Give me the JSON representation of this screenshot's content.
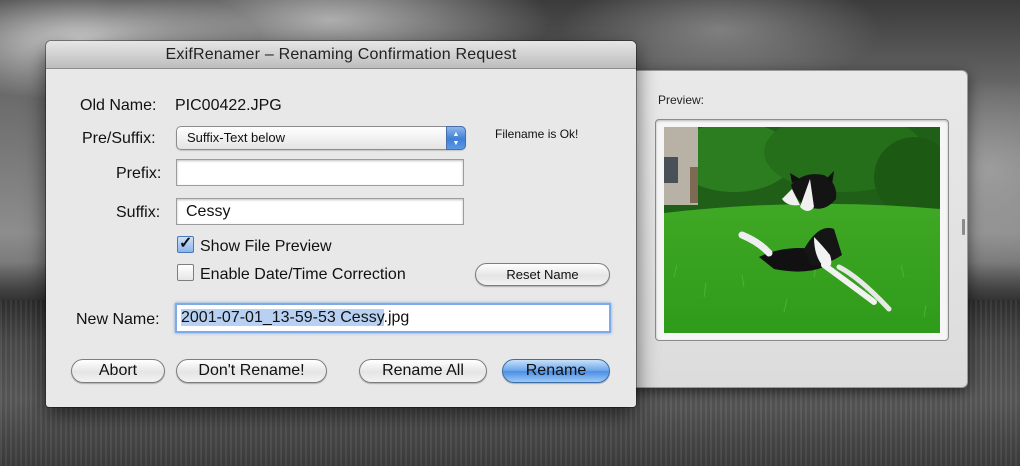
{
  "window": {
    "title": "ExifRenamer  –  Renaming Confirmation Request"
  },
  "form": {
    "old_name_label": "Old Name:",
    "old_name_value": "PIC00422.JPG",
    "presuffix_label": "Pre/Suffix:",
    "presuffix_value": "Suffix-Text below",
    "status_text": "Filename is Ok!",
    "prefix_label": "Prefix:",
    "prefix_value": "",
    "suffix_label": "Suffix:",
    "suffix_value": "Cessy",
    "show_preview_label": "Show File Preview",
    "show_preview_checked": true,
    "date_correction_label": "Enable Date/Time Correction",
    "date_correction_checked": false,
    "reset_name_label": "Reset Name",
    "new_name_label": "New Name:",
    "new_name_selected": "2001-07-01_13-59-53 Cessy",
    "new_name_rest": ".jpg"
  },
  "buttons": {
    "abort": "Abort",
    "dont_rename": "Don't Rename!",
    "rename_all": "Rename All",
    "rename": "Rename"
  },
  "preview": {
    "label": "Preview:"
  },
  "icons": {
    "popup": "updown-arrows-icon",
    "checkbox": "checkmark-icon"
  },
  "colors": {
    "accent": "#4a8ee6",
    "selection": "#b8d1f3"
  }
}
